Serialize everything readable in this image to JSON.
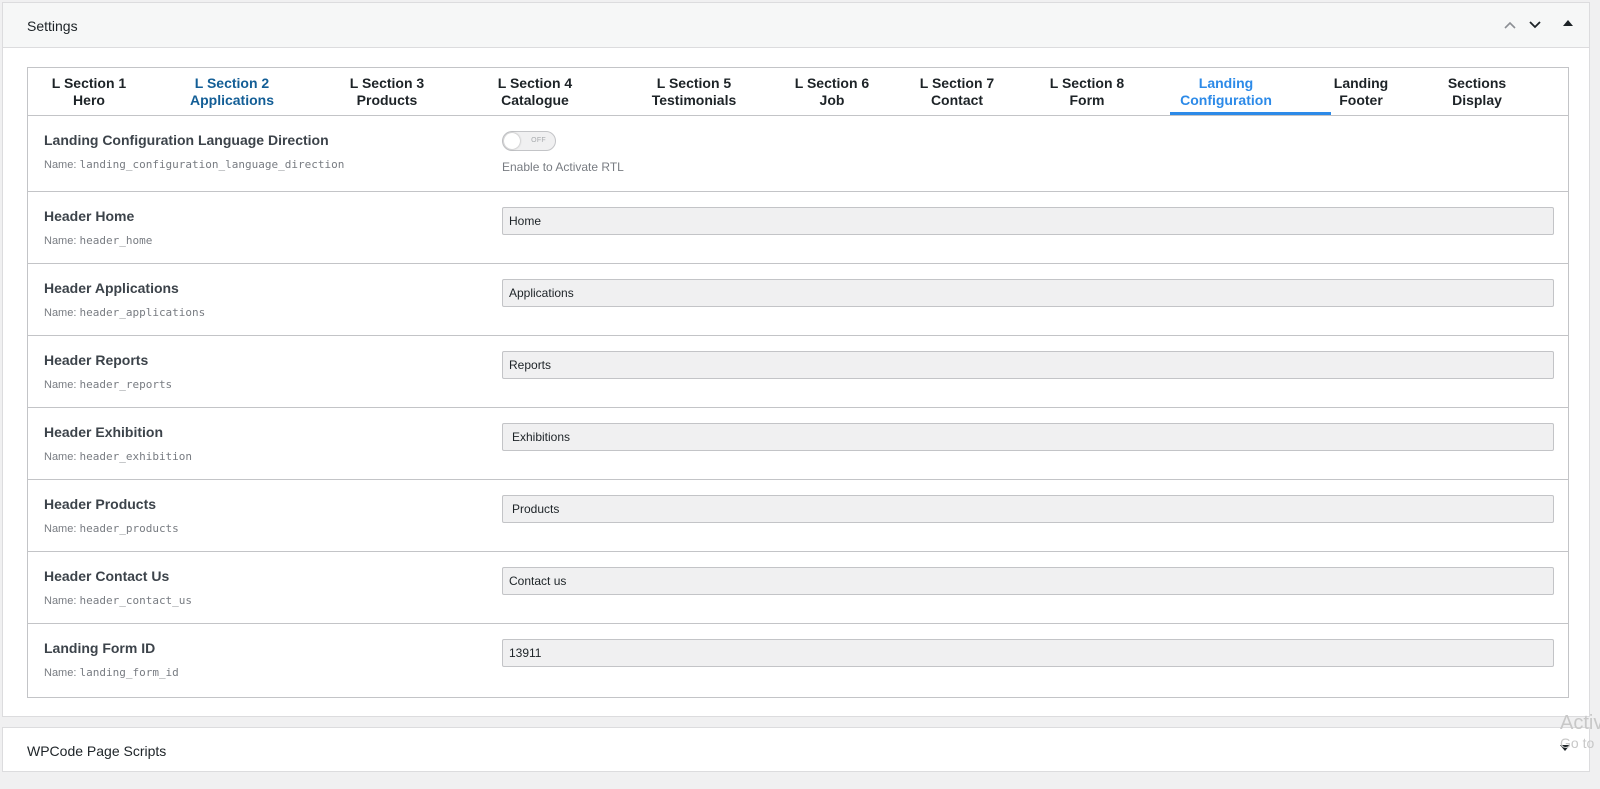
{
  "settings_panel": {
    "title": "Settings",
    "move_up_icon": "chevron-up-icon",
    "move_down_icon": "chevron-down-icon",
    "toggle_icon": "triangle-up-icon"
  },
  "tabs": [
    {
      "line1": "L Section 1",
      "line2": "Hero",
      "state": "normal"
    },
    {
      "line1": "L Section 2",
      "line2": "Applications",
      "state": "visited"
    },
    {
      "line1": "L Section 3",
      "line2": "Products",
      "state": "normal"
    },
    {
      "line1": "L Section 4",
      "line2": "Catalogue",
      "state": "normal"
    },
    {
      "line1": "L Section 5",
      "line2": "Testimonials",
      "state": "normal"
    },
    {
      "line1": "L Section 6",
      "line2": "Job",
      "state": "normal"
    },
    {
      "line1": "L Section 7",
      "line2": "Contact",
      "state": "normal"
    },
    {
      "line1": "L Section 8",
      "line2": "Form",
      "state": "normal"
    },
    {
      "line1": "Landing",
      "line2": "Configuration",
      "state": "active"
    },
    {
      "line1": "Landing",
      "line2": "Footer",
      "state": "normal"
    },
    {
      "line1": "Sections",
      "line2": "Display",
      "state": "normal"
    }
  ],
  "colors": {
    "active_tab": "#2c8ae8",
    "visited_tab": "#135e96"
  },
  "language_direction": {
    "label": "Landing Configuration Language Direction",
    "name_prefix": "Name:",
    "name": "landing_configuration_language_direction",
    "toggle_state": "OFF",
    "description": "Enable to Activate RTL"
  },
  "fields": [
    {
      "label": "Header Home",
      "name_prefix": "Name:",
      "name": "header_home",
      "value": "Home"
    },
    {
      "label": "Header Applications",
      "name_prefix": "Name:",
      "name": "header_applications",
      "value": "Applications"
    },
    {
      "label": "Header Reports",
      "name_prefix": "Name:",
      "name": "header_reports",
      "value": "Reports"
    },
    {
      "label": "Header Exhibition",
      "name_prefix": "Name:",
      "name": "header_exhibition",
      "value": "Exhibitions"
    },
    {
      "label": "Header Products",
      "name_prefix": "Name:",
      "name": "header_products",
      "value": "Products"
    },
    {
      "label": "Header Contact Us",
      "name_prefix": "Name:",
      "name": "header_contact_us",
      "value": "Contact us"
    },
    {
      "label": "Landing Form ID",
      "name_prefix": "Name:",
      "name": "landing_form_id",
      "value": "13911"
    }
  ],
  "wpcode_panel": {
    "title": "WPCode Page Scripts",
    "toggle_icon": "triangle-down-icon"
  },
  "watermark": {
    "line1": "Activ",
    "line2": "Go to"
  }
}
